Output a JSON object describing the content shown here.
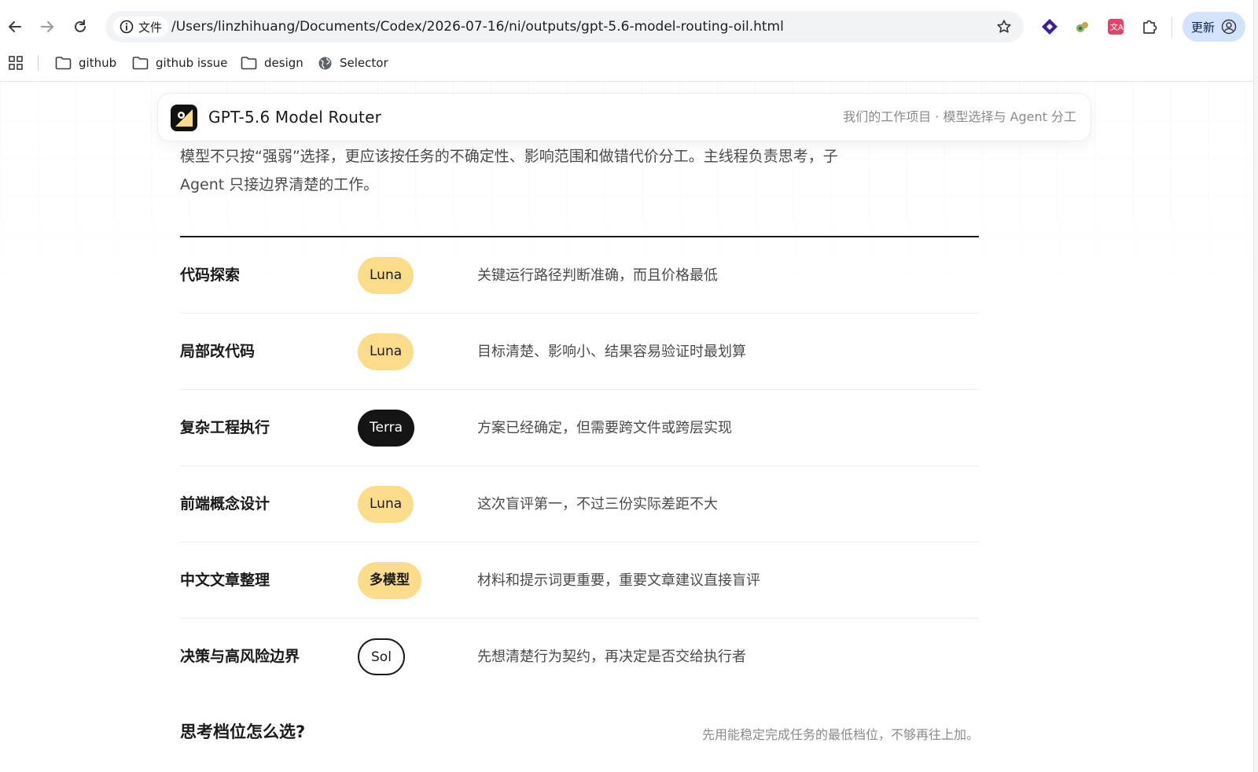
{
  "browser": {
    "site_info_label": "文件",
    "url": "/Users/linzhihuang/Documents/Codex/2026-07-16/ni/outputs/gpt-5.6-model-routing-oil.html",
    "update_label": "更新",
    "bookmarks": [
      {
        "label": "github",
        "icon": "folder-icon"
      },
      {
        "label": "github issue",
        "icon": "folder-icon"
      },
      {
        "label": "design",
        "icon": "folder-icon"
      },
      {
        "label": "Selector",
        "icon": "globe-icon"
      }
    ]
  },
  "header": {
    "title": "GPT-5.6 Model Router",
    "subtitle": "我们的工作项目 · 模型选择与 Agent 分工"
  },
  "intro": {
    "line1": "模型不只按“强弱”选择，更应该按任务的不确定性、影响范围和做错代价分工。主线程负责思考，子",
    "line2": "Agent 只接边界清楚的工作。"
  },
  "routing": {
    "rows": [
      {
        "task": "代码探索",
        "model": "Luna",
        "reason": "关键运行路径判断准确，而且价格最低"
      },
      {
        "task": "局部改代码",
        "model": "Luna",
        "reason": "目标清楚、影响小、结果容易验证时最划算"
      },
      {
        "task": "复杂工程执行",
        "model": "Terra",
        "reason": "方案已经确定，但需要跨文件或跨层实现"
      },
      {
        "task": "前端概念设计",
        "model": "Luna",
        "reason": "这次盲评第一，不过三份实际差距不大"
      },
      {
        "task": "中文文章整理",
        "model": "多模型",
        "reason": "材料和提示词更重要，重要文章建议直接盲评"
      },
      {
        "task": "决策与高风险边界",
        "model": "Sol",
        "reason": "先想清楚行为契约，再决定是否交给执行者"
      }
    ]
  },
  "next_section": {
    "title": "思考档位怎么选?",
    "note": "先用能稳定完成任务的最低档位，不够再往上加。"
  },
  "colors": {
    "luna_pill": "#fbdc8a",
    "terra_pill": "#141414",
    "sol_pill_border": "#1a1a1a",
    "update_button": "#d3e3fd"
  }
}
